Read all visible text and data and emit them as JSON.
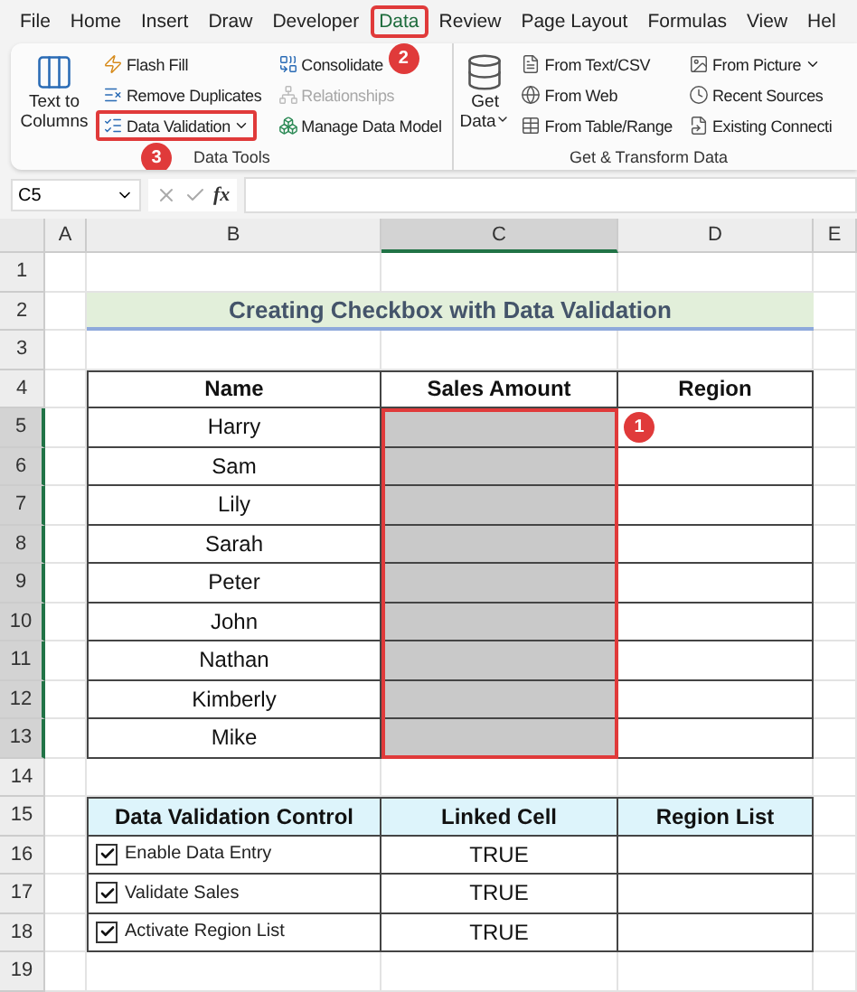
{
  "ribbon_tabs": [
    {
      "label": "File",
      "selected": false
    },
    {
      "label": "Home",
      "selected": false
    },
    {
      "label": "Insert",
      "selected": false
    },
    {
      "label": "Draw",
      "selected": false
    },
    {
      "label": "Developer",
      "selected": false
    },
    {
      "label": "Data",
      "selected": true,
      "callout": "2"
    },
    {
      "label": "Review",
      "selected": false
    },
    {
      "label": "Page Layout",
      "selected": false
    },
    {
      "label": "Formulas",
      "selected": false
    },
    {
      "label": "View",
      "selected": false
    },
    {
      "label": "Hel",
      "selected": false
    }
  ],
  "ribbon_groups": [
    {
      "label": "Data Tools",
      "items": [
        {
          "kind": "large",
          "label": "Text to Columns",
          "dropdown": false,
          "disabled": false
        },
        {
          "kind": "small",
          "label": "Flash Fill",
          "dropdown": false,
          "disabled": false
        },
        {
          "kind": "small",
          "label": "Remove Duplicates",
          "dropdown": false,
          "disabled": false
        },
        {
          "kind": "small",
          "label": "Data Validation",
          "dropdown": true,
          "disabled": false,
          "callout": "3"
        },
        {
          "kind": "small",
          "label": "Consolidate",
          "dropdown": false,
          "disabled": false
        },
        {
          "kind": "small",
          "label": "Relationships",
          "dropdown": false,
          "disabled": true
        },
        {
          "kind": "small",
          "label": "Manage Data Model",
          "dropdown": false,
          "disabled": false
        }
      ]
    },
    {
      "label": "Get & Transform Data",
      "items": [
        {
          "kind": "large",
          "label": "Get Data",
          "dropdown": true,
          "disabled": false
        },
        {
          "kind": "small",
          "label": "From Text/CSV",
          "dropdown": false,
          "disabled": false
        },
        {
          "kind": "small",
          "label": "From Web",
          "dropdown": false,
          "disabled": false
        },
        {
          "kind": "small",
          "label": "From Table/Range",
          "dropdown": false,
          "disabled": false
        },
        {
          "kind": "small",
          "label": "From Picture",
          "dropdown": true,
          "disabled": false
        },
        {
          "kind": "small",
          "label": "Recent Sources",
          "dropdown": false,
          "disabled": false
        },
        {
          "kind": "small",
          "label": "Existing Connecti",
          "dropdown": false,
          "disabled": false
        }
      ]
    }
  ],
  "formula_bar": {
    "name_box": "C5",
    "function_label": "fx"
  },
  "columns": [
    {
      "label": "A",
      "selected": false
    },
    {
      "label": "B",
      "selected": false
    },
    {
      "label": "C",
      "selected": true
    },
    {
      "label": "D",
      "selected": false
    },
    {
      "label": "E",
      "selected": false
    }
  ],
  "rows": [
    {
      "label": "1",
      "selected": false
    },
    {
      "label": "2",
      "selected": false
    },
    {
      "label": "3",
      "selected": false
    },
    {
      "label": "4",
      "selected": false
    },
    {
      "label": "5",
      "selected": true
    },
    {
      "label": "6",
      "selected": true
    },
    {
      "label": "7",
      "selected": true
    },
    {
      "label": "8",
      "selected": true
    },
    {
      "label": "9",
      "selected": true
    },
    {
      "label": "10",
      "selected": true
    },
    {
      "label": "11",
      "selected": true
    },
    {
      "label": "12",
      "selected": true
    },
    {
      "label": "13",
      "selected": true
    },
    {
      "label": "14",
      "selected": false
    },
    {
      "label": "15",
      "selected": false
    },
    {
      "label": "16",
      "selected": false
    },
    {
      "label": "17",
      "selected": false
    },
    {
      "label": "18",
      "selected": false
    },
    {
      "label": "19",
      "selected": false
    }
  ],
  "title": "Creating Checkbox with Data Validation",
  "sales_table": {
    "headers": [
      "Name",
      "Sales Amount",
      "Region"
    ],
    "callout": "1",
    "rows": [
      {
        "name": "Harry"
      },
      {
        "name": "Sam"
      },
      {
        "name": "Lily"
      },
      {
        "name": "Sarah"
      },
      {
        "name": "Peter"
      },
      {
        "name": "John"
      },
      {
        "name": "Nathan"
      },
      {
        "name": "Kimberly"
      },
      {
        "name": "Mike"
      }
    ]
  },
  "control_table": {
    "headers": [
      "Data Validation Control",
      "Linked Cell",
      "Region List"
    ],
    "rows": [
      {
        "label": "Enable Data Entry",
        "checked": true,
        "linked_cell": "TRUE"
      },
      {
        "label": "Validate Sales",
        "checked": true,
        "linked_cell": "TRUE"
      },
      {
        "label": "Activate Region List",
        "checked": true,
        "linked_cell": "TRUE"
      }
    ]
  }
}
